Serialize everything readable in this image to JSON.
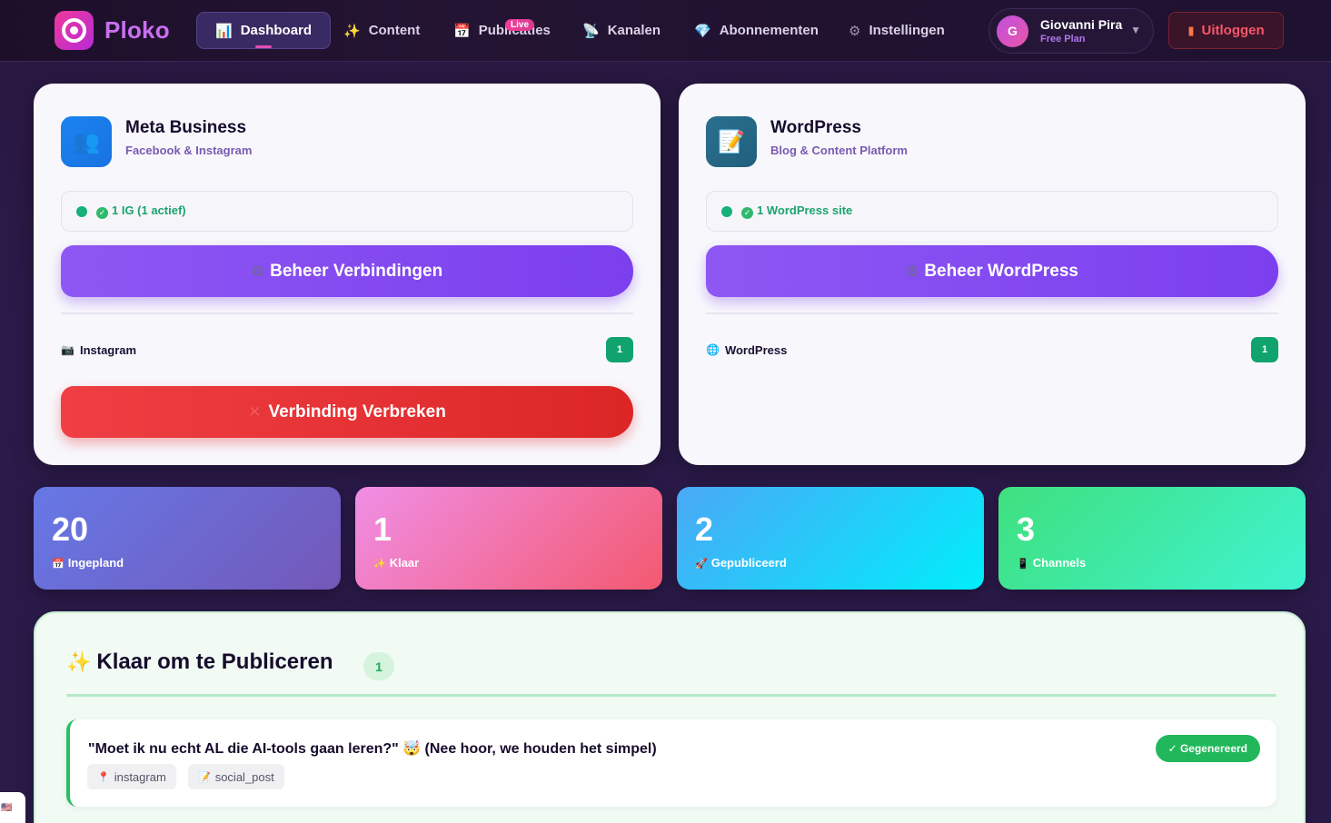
{
  "brand": {
    "name": "Ploko"
  },
  "nav": {
    "items": [
      {
        "icon": "📊",
        "label": "Dashboard"
      },
      {
        "icon": "✨",
        "label": "Content"
      },
      {
        "icon": "📅",
        "label": "Publicaties",
        "badge": "Live"
      },
      {
        "icon": "📡",
        "label": "Kanalen"
      },
      {
        "icon": "💎",
        "label": "Abonnementen"
      },
      {
        "icon": "⚙",
        "label": "Instellingen"
      }
    ]
  },
  "user": {
    "initial": "G",
    "name": "Giovanni Pira",
    "plan": "Free Plan",
    "caret": "▼"
  },
  "logout": {
    "icon": "▮",
    "label": "Uitloggen"
  },
  "platforms": {
    "meta": {
      "icon": "👥",
      "title": "Meta Business",
      "subtitle": "Facebook & Instagram",
      "status": "1 IG (1 actief)",
      "status_check": "✓",
      "manage_icon": "⚙",
      "manage_label": "Beheer Verbindingen",
      "row_icon": "📷",
      "row_name": "Instagram",
      "row_count": "1",
      "disconnect_icon": "✕",
      "disconnect_label": "Verbinding Verbreken"
    },
    "wordpress": {
      "icon": "📝",
      "title": "WordPress",
      "subtitle": "Blog & Content Platform",
      "status": "1 WordPress site",
      "status_check": "✓",
      "manage_icon": "⚙",
      "manage_label": "Beheer WordPress",
      "row_icon": "🌐",
      "row_name": "WordPress",
      "row_count": "1"
    }
  },
  "stats": [
    {
      "value": "20",
      "icon": "📅",
      "label": "Ingepland"
    },
    {
      "value": "1",
      "icon": "✨",
      "label": "Klaar"
    },
    {
      "value": "2",
      "icon": "🚀",
      "label": "Gepubliceerd"
    },
    {
      "value": "3",
      "icon": "📱",
      "label": "Channels"
    }
  ],
  "ready": {
    "icon": "✨",
    "title": "Klaar om te Publiceren",
    "count": "1",
    "post": {
      "title": "\"Moet ik nu echt AL die AI-tools gaan leren?\" 🤯 (Nee hoor, we houden het simpel)",
      "badge": "✓ Gegenereerd",
      "tags": [
        {
          "icon": "📍",
          "label": "instagram"
        },
        {
          "icon": "📝",
          "label": "social_post"
        }
      ]
    }
  },
  "locale_flag": "🇺🇸"
}
